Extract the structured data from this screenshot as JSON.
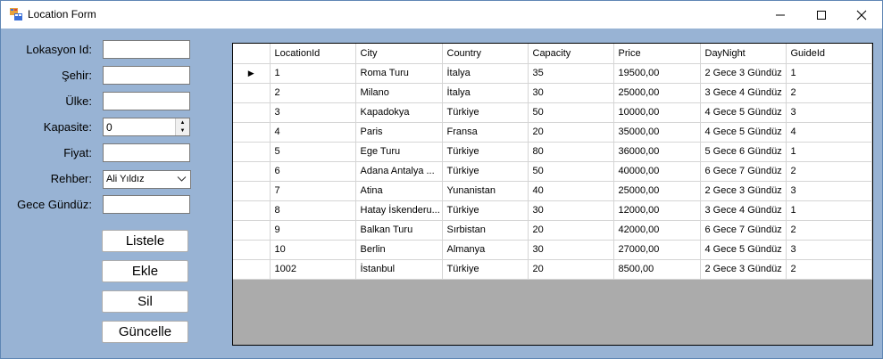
{
  "window": {
    "title": "Location Form"
  },
  "form": {
    "labels": {
      "location_id": "Lokasyon Id:",
      "city": "Şehir:",
      "country": "Ülke:",
      "capacity": "Kapasite:",
      "price": "Fiyat:",
      "guide": "Rehber:",
      "day_night": "Gece Gündüz:"
    },
    "values": {
      "location_id": "",
      "city": "",
      "country": "",
      "capacity": "0",
      "price": "",
      "guide": "Ali Yıldız",
      "day_night": ""
    },
    "buttons": {
      "list": "Listele",
      "add": "Ekle",
      "delete": "Sil",
      "update": "Güncelle"
    }
  },
  "grid": {
    "columns": [
      "LocationId",
      "City",
      "Country",
      "Capacity",
      "Price",
      "DayNight",
      "GuideId"
    ],
    "rows": [
      [
        "1",
        "Roma Turu",
        "İtalya",
        "35",
        "19500,00",
        "2 Gece 3 Gündüz",
        "1"
      ],
      [
        "2",
        "Milano",
        "İtalya",
        "30",
        "25000,00",
        "3 Gece 4 Gündüz",
        "2"
      ],
      [
        "3",
        "Kapadokya",
        "Türkiye",
        "50",
        "10000,00",
        "4 Gece 5 Gündüz",
        "3"
      ],
      [
        "4",
        "Paris",
        "Fransa",
        "20",
        "35000,00",
        "4 Gece 5 Gündüz",
        "4"
      ],
      [
        "5",
        "Ege Turu",
        "Türkiye",
        "80",
        "36000,00",
        "5 Gece 6 Gündüz",
        "1"
      ],
      [
        "6",
        "Adana Antalya ...",
        "Türkiye",
        "50",
        "40000,00",
        "6 Gece 7 Gündüz",
        "2"
      ],
      [
        "7",
        "Atina",
        "Yunanistan",
        "40",
        "25000,00",
        "2 Gece 3 Gündüz",
        "3"
      ],
      [
        "8",
        "Hatay İskenderu...",
        "Türkiye",
        "30",
        "12000,00",
        "3 Gece 4 Gündüz",
        "1"
      ],
      [
        "9",
        "Balkan Turu",
        "Sırbistan",
        "20",
        "42000,00",
        "6 Gece 7 Gündüz",
        "2"
      ],
      [
        "10",
        "Berlin",
        "Almanya",
        "30",
        "27000,00",
        "4 Gece 5 Gündüz",
        "3"
      ],
      [
        "1002",
        "İstanbul",
        "Türkiye",
        "20",
        "8500,00",
        "2 Gece 3 Gündüz",
        "2"
      ]
    ],
    "current_row_marker": "▶"
  },
  "icons": {
    "app": "form-app-icon",
    "minimize": "minimize-icon",
    "maximize": "maximize-icon",
    "close": "close-icon",
    "dropdown": "chevron-down-icon"
  }
}
